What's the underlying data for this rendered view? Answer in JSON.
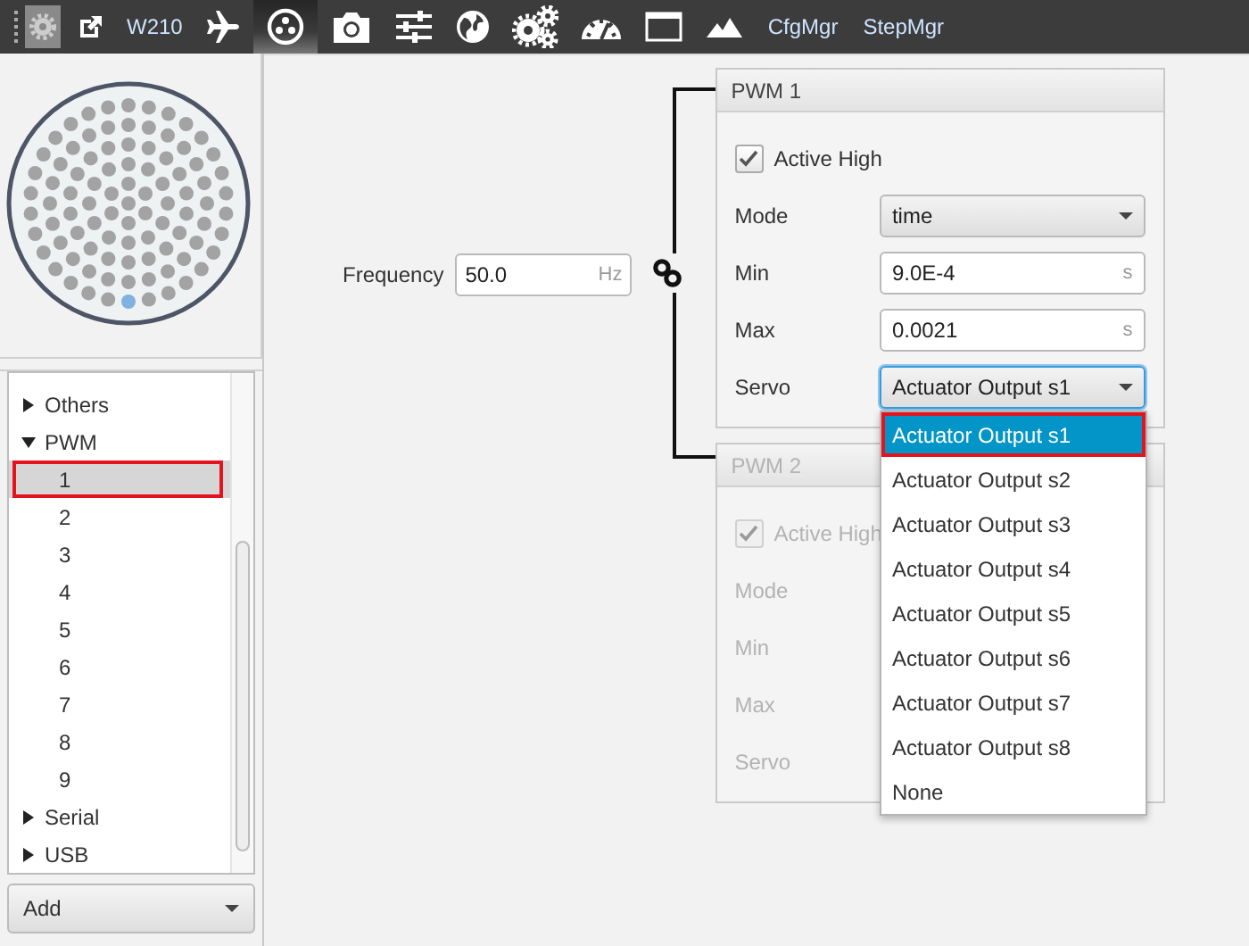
{
  "toolbar": {
    "settings_button": {
      "on": true
    },
    "items": [
      {
        "kind": "icon",
        "selected": false
      },
      {
        "kind": "text",
        "label": "W210",
        "selected": false
      },
      {
        "kind": "icon",
        "selected": false
      },
      {
        "kind": "icon",
        "selected": true
      },
      {
        "kind": "icon",
        "selected": false
      },
      {
        "kind": "icon",
        "selected": false
      },
      {
        "kind": "icon",
        "selected": false
      },
      {
        "kind": "icon",
        "selected": false
      },
      {
        "kind": "icon",
        "selected": false
      },
      {
        "kind": "icon",
        "selected": false
      },
      {
        "kind": "icon",
        "selected": false
      },
      {
        "kind": "text",
        "label": "CfgMgr",
        "selected": false
      },
      {
        "kind": "text",
        "label": "StepMgr",
        "selected": false
      }
    ]
  },
  "tree": [
    {
      "label": "Others",
      "expanded": false
    },
    {
      "label": "PWM",
      "expanded": true,
      "children": [
        {
          "label": "1",
          "selected": true,
          "highlighted": true
        },
        {
          "label": "2",
          "selected": false,
          "highlighted": false
        },
        {
          "label": "3",
          "selected": false,
          "highlighted": false
        },
        {
          "label": "4",
          "selected": false,
          "highlighted": false
        },
        {
          "label": "5",
          "selected": false,
          "highlighted": false
        },
        {
          "label": "6",
          "selected": false,
          "highlighted": false
        },
        {
          "label": "7",
          "selected": false,
          "highlighted": false
        },
        {
          "label": "8",
          "selected": false,
          "highlighted": false
        },
        {
          "label": "9",
          "selected": false,
          "highlighted": false
        }
      ]
    },
    {
      "label": "Serial",
      "expanded": false
    },
    {
      "label": "USB",
      "expanded": false
    }
  ],
  "add_button": {
    "label": "Add"
  },
  "frequency": {
    "label": "Frequency",
    "value": "50.0",
    "unit": "Hz"
  },
  "panels": [
    {
      "title": "PWM 1",
      "disabled": false,
      "active_high": {
        "label": "Active High",
        "checked": true
      },
      "fields": [
        {
          "kind": "select",
          "label": "Mode",
          "value": "time",
          "focused": false
        },
        {
          "kind": "number",
          "label": "Min",
          "value": "9.0E-4",
          "unit": "s"
        },
        {
          "kind": "number",
          "label": "Max",
          "value": "0.0021",
          "unit": "s"
        },
        {
          "kind": "select",
          "label": "Servo",
          "value": "Actuator Output s1",
          "focused": true
        }
      ]
    },
    {
      "title": "PWM 2",
      "disabled": true,
      "active_high": {
        "label": "Active High",
        "checked": true
      },
      "fields": [
        {
          "label": "Mode"
        },
        {
          "label": "Min"
        },
        {
          "label": "Max"
        },
        {
          "label": "Servo"
        }
      ]
    }
  ],
  "dropdown": {
    "options": [
      {
        "label": "Actuator Output s1",
        "selected": true,
        "highlighted": true
      },
      {
        "label": "Actuator Output s2",
        "selected": false,
        "highlighted": false
      },
      {
        "label": "Actuator Output s3",
        "selected": false,
        "highlighted": false
      },
      {
        "label": "Actuator Output s4",
        "selected": false,
        "highlighted": false
      },
      {
        "label": "Actuator Output s5",
        "selected": false,
        "highlighted": false
      },
      {
        "label": "Actuator Output s6",
        "selected": false,
        "highlighted": false
      },
      {
        "label": "Actuator Output s7",
        "selected": false,
        "highlighted": false
      },
      {
        "label": "Actuator Output s8",
        "selected": false,
        "highlighted": false
      },
      {
        "label": "None",
        "selected": false,
        "highlighted": false
      }
    ]
  }
}
